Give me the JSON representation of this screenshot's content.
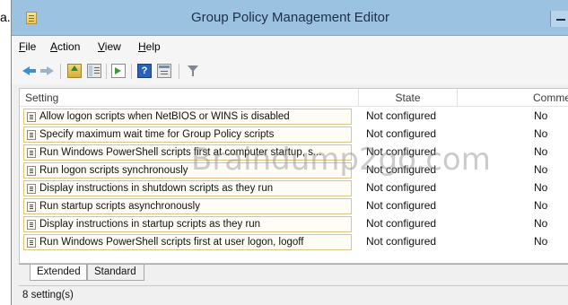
{
  "stray_letter": "a.",
  "window": {
    "title": "Group Policy Management Editor"
  },
  "menu": [
    "File",
    "Action",
    "View",
    "Help"
  ],
  "toolbar": {
    "icons": [
      "back-icon",
      "forward-icon",
      "up-folder-icon",
      "show-hide-tree-icon",
      "export-list-icon",
      "help-icon",
      "properties-icon",
      "filter-icon"
    ]
  },
  "list": {
    "columns": {
      "setting": "Setting",
      "state": "State",
      "comment": "Commer"
    },
    "rows": [
      {
        "setting": "Allow logon scripts when NetBIOS or WINS is disabled",
        "state": "Not configured",
        "comment": "No"
      },
      {
        "setting": "Specify maximum wait time for Group Policy scripts",
        "state": "Not configured",
        "comment": "No"
      },
      {
        "setting": "Run Windows PowerShell scripts first at computer startup, s...",
        "state": "Not configured",
        "comment": "No"
      },
      {
        "setting": "Run logon scripts synchronously",
        "state": "Not configured",
        "comment": "No"
      },
      {
        "setting": "Display instructions in shutdown scripts as they run",
        "state": "Not configured",
        "comment": "No"
      },
      {
        "setting": "Run startup scripts asynchronously",
        "state": "Not configured",
        "comment": "No"
      },
      {
        "setting": "Display instructions in startup scripts as they run",
        "state": "Not configured",
        "comment": "No"
      },
      {
        "setting": "Run Windows PowerShell scripts first at user logon, logoff",
        "state": "Not configured",
        "comment": "No"
      }
    ]
  },
  "watermark": "Braindump2go.com",
  "tabs": [
    "Extended",
    "Standard"
  ],
  "status": "8 setting(s)",
  "colors": {
    "titlebar": "#9cc2e2",
    "row_border": "#e2c37a",
    "background": "#f0f0f0"
  }
}
